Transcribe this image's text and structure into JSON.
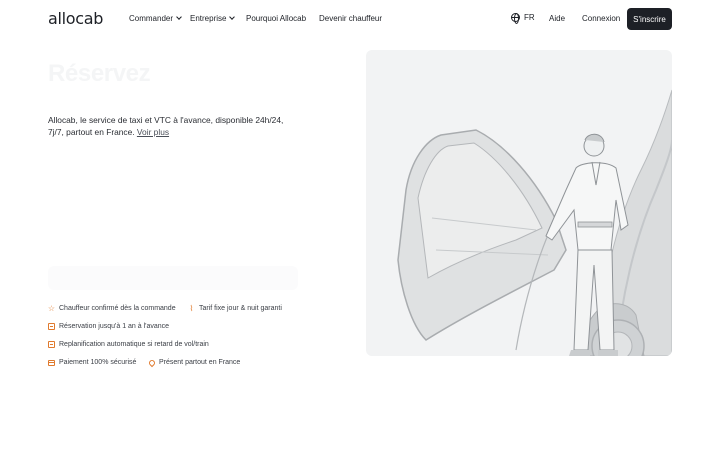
{
  "brand": {
    "logo": "allocab"
  },
  "nav": {
    "items": [
      {
        "label": "Commander",
        "has_dropdown": true
      },
      {
        "label": "Entreprise",
        "has_dropdown": true
      },
      {
        "label": "Pourquoi Allocab",
        "has_dropdown": false
      },
      {
        "label": "Devenir chauffeur",
        "has_dropdown": false
      }
    ],
    "language": "FR",
    "help": "Aide",
    "login": "Connexion",
    "signup": "S'inscrire"
  },
  "hero": {
    "title": "Réservez",
    "description": "Allocab, le service de taxi et VTC à l'avance, disponible 24h/24, 7j/7, partout en France.",
    "more_link": "Voir plus"
  },
  "features": [
    {
      "icon": "star-icon",
      "label": "Chauffeur confirmé dès la commande"
    },
    {
      "icon": "tag-icon",
      "label": "Tarif fixe jour & nuit garanti"
    },
    {
      "icon": "calendar-icon",
      "label": "Réservation jusqu'à 1 an à l'avance"
    },
    {
      "icon": "schedule-icon",
      "label": "Replanification automatique si retard de vol/train"
    },
    {
      "icon": "credit-card-icon",
      "label": "Paiement 100% sécurisé"
    },
    {
      "icon": "location-pin-icon",
      "label": "Présent partout en France"
    }
  ],
  "colors": {
    "accent": "#e07a2d",
    "dark": "#1d2026",
    "panel_bg": "#f2f3f4"
  }
}
